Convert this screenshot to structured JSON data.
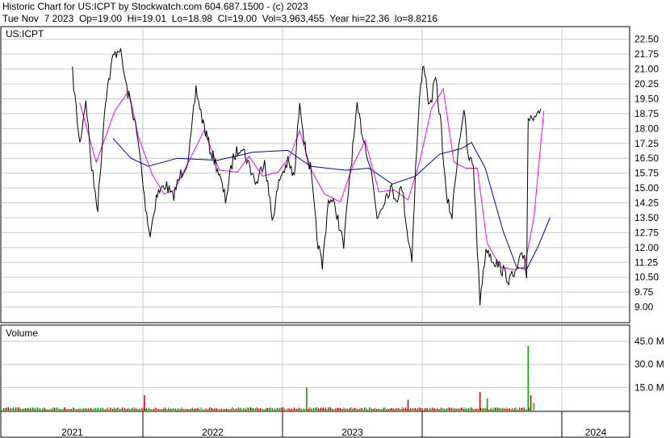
{
  "header": {
    "line1": "Historic Chart for US:ICPT by Stockwatch.com 604.687.1500 - (c) 2023",
    "line2": "Tue Nov  7 2023  Op=19.00  Hi=19.01  Lo=18.98  Cl=19.00  Vol=3,963,455  Year hi=22.36  lo=8.8216"
  },
  "price_panel": {
    "symbol": "US:ICPT"
  },
  "volume_panel": {
    "label": "Volume"
  },
  "colors": {
    "price": "#000000",
    "short_ma": "#ff00ff",
    "long_ma": "#0000cc",
    "vol_up": "#00aa00",
    "vol_down": "#dd0000",
    "grid": "#c8c8c8"
  },
  "chart_data": [
    {
      "type": "line",
      "title": "US:ICPT",
      "x_axis_labels": [
        "2021",
        "2022",
        "2023",
        "2024"
      ],
      "y_ticks": [
        "22.50",
        "21.75",
        "21.00",
        "20.25",
        "19.50",
        "18.75",
        "18.00",
        "17.25",
        "16.50",
        "15.75",
        "15.00",
        "14.25",
        "13.50",
        "12.75",
        "12.00",
        "11.25",
        "10.50",
        "9.75",
        "9.00"
      ],
      "ylim": [
        8.25,
        23.1
      ],
      "grid": true,
      "series": [
        {
          "name": "Price",
          "points": [
            [
              "2020-07-01",
              20.8
            ],
            [
              "2020-07-20",
              17.2
            ],
            [
              "2020-08-05",
              19.5
            ],
            [
              "2020-08-20",
              16.0
            ],
            [
              "2020-09-05",
              14.0
            ],
            [
              "2020-09-25",
              19.5
            ],
            [
              "2020-10-15",
              21.6
            ],
            [
              "2020-11-01",
              22.1
            ],
            [
              "2020-11-20",
              20.0
            ],
            [
              "2020-12-10",
              18.5
            ],
            [
              "2020-12-25",
              16.5
            ],
            [
              "2021-01-05",
              14.5
            ],
            [
              "2021-01-20",
              12.6
            ],
            [
              "2021-02-05",
              14.6
            ],
            [
              "2021-03-01",
              15.2
            ],
            [
              "2021-03-20",
              14.5
            ],
            [
              "2021-04-10",
              15.7
            ],
            [
              "2021-05-01",
              16.5
            ],
            [
              "2021-05-20",
              20.0
            ],
            [
              "2021-06-05",
              18.5
            ],
            [
              "2021-06-25",
              17.0
            ],
            [
              "2021-07-15",
              16.0
            ],
            [
              "2021-08-05",
              14.4
            ],
            [
              "2021-08-25",
              16.5
            ],
            [
              "2021-09-15",
              17.2
            ],
            [
              "2021-10-05",
              16.2
            ],
            [
              "2021-10-25",
              15.2
            ],
            [
              "2021-11-15",
              16.5
            ],
            [
              "2021-12-05",
              13.4
            ],
            [
              "2021-12-25",
              15.5
            ],
            [
              "2022-01-15",
              16.3
            ],
            [
              "2022-02-01",
              15.5
            ],
            [
              "2022-02-15",
              19.5
            ],
            [
              "2022-03-01",
              17.0
            ],
            [
              "2022-03-15",
              16.0
            ],
            [
              "2022-04-01",
              12.5
            ],
            [
              "2022-04-15",
              11.0
            ],
            [
              "2022-05-01",
              14.5
            ],
            [
              "2022-05-20",
              14.0
            ],
            [
              "2022-06-10",
              12.0
            ],
            [
              "2022-06-25",
              15.5
            ],
            [
              "2022-07-15",
              19.0
            ],
            [
              "2022-08-01",
              17.5
            ],
            [
              "2022-08-20",
              16.0
            ],
            [
              "2022-09-05",
              13.5
            ],
            [
              "2022-09-25",
              14.5
            ],
            [
              "2022-10-10",
              15.0
            ],
            [
              "2022-10-25",
              14.5
            ],
            [
              "2022-11-10",
              15.0
            ],
            [
              "2022-11-25",
              12.5
            ],
            [
              "2022-12-05",
              11.5
            ],
            [
              "2022-12-15",
              16.0
            ],
            [
              "2022-12-25",
              19.5
            ],
            [
              "2023-01-05",
              21.4
            ],
            [
              "2023-01-20",
              19.0
            ],
            [
              "2023-02-05",
              20.5
            ],
            [
              "2023-02-20",
              18.0
            ],
            [
              "2023-03-05",
              14.5
            ],
            [
              "2023-03-20",
              13.6
            ],
            [
              "2023-04-05",
              17.0
            ],
            [
              "2023-04-20",
              19.0
            ],
            [
              "2023-05-01",
              16.5
            ],
            [
              "2023-05-15",
              16.2
            ],
            [
              "2023-05-25",
              12.0
            ],
            [
              "2023-06-01",
              9.2
            ],
            [
              "2023-06-10",
              11.0
            ],
            [
              "2023-06-20",
              12.0
            ],
            [
              "2023-07-01",
              11.5
            ],
            [
              "2023-07-15",
              11.2
            ],
            [
              "2023-08-01",
              10.8
            ],
            [
              "2023-08-15",
              10.4
            ],
            [
              "2023-09-01",
              10.6
            ],
            [
              "2023-09-15",
              11.4
            ],
            [
              "2023-09-25",
              11.6
            ],
            [
              "2023-10-01",
              10.6
            ],
            [
              "2023-10-05",
              18.5
            ],
            [
              "2023-10-15",
              18.6
            ],
            [
              "2023-10-25",
              18.9
            ],
            [
              "2023-11-07",
              19.0
            ]
          ]
        },
        {
          "name": "Short MA",
          "points": [
            [
              "2020-07-20",
              19.3
            ],
            [
              "2020-09-01",
              16.3
            ],
            [
              "2020-10-20",
              18.9
            ],
            [
              "2020-11-25",
              19.9
            ],
            [
              "2020-12-20",
              17.6
            ],
            [
              "2021-01-25",
              15.7
            ],
            [
              "2021-02-25",
              14.7
            ],
            [
              "2021-03-25",
              14.9
            ],
            [
              "2021-05-05",
              16.5
            ],
            [
              "2021-06-10",
              17.9
            ],
            [
              "2021-07-20",
              15.9
            ],
            [
              "2021-09-05",
              15.8
            ],
            [
              "2021-10-05",
              16.6
            ],
            [
              "2021-11-10",
              15.6
            ],
            [
              "2021-12-20",
              15.8
            ],
            [
              "2022-01-20",
              16.6
            ],
            [
              "2022-02-15",
              17.9
            ],
            [
              "2022-03-15",
              16.0
            ],
            [
              "2022-04-20",
              14.7
            ],
            [
              "2022-06-01",
              14.3
            ],
            [
              "2022-07-05",
              16.2
            ],
            [
              "2022-08-05",
              17.4
            ],
            [
              "2022-09-10",
              14.8
            ],
            [
              "2022-10-20",
              14.9
            ],
            [
              "2022-11-25",
              14.4
            ],
            [
              "2022-12-25",
              16.3
            ],
            [
              "2023-01-25",
              19.0
            ],
            [
              "2023-02-25",
              20.0
            ],
            [
              "2023-03-25",
              16.3
            ],
            [
              "2023-04-25",
              16.0
            ],
            [
              "2023-05-25",
              16.0
            ],
            [
              "2023-06-20",
              12.2
            ],
            [
              "2023-07-25",
              11.0
            ],
            [
              "2023-08-25",
              10.9
            ],
            [
              "2023-09-25",
              11.0
            ],
            [
              "2023-10-20",
              13.5
            ],
            [
              "2023-11-15",
              18.9
            ]
          ]
        },
        {
          "name": "Long MA",
          "points": [
            [
              "2020-10-15",
              17.5
            ],
            [
              "2020-12-01",
              16.5
            ],
            [
              "2021-01-15",
              16.1
            ],
            [
              "2021-04-01",
              16.5
            ],
            [
              "2021-07-15",
              16.4
            ],
            [
              "2021-10-15",
              16.8
            ],
            [
              "2022-01-15",
              16.9
            ],
            [
              "2022-03-15",
              16.1
            ],
            [
              "2022-06-15",
              15.9
            ],
            [
              "2022-08-15",
              16.0
            ],
            [
              "2022-10-15",
              15.2
            ],
            [
              "2022-12-15",
              15.6
            ],
            [
              "2023-02-15",
              16.7
            ],
            [
              "2023-04-15",
              17.0
            ],
            [
              "2023-05-10",
              17.3
            ],
            [
              "2023-06-15",
              16.0
            ],
            [
              "2023-08-01",
              12.8
            ],
            [
              "2023-09-05",
              11.0
            ],
            [
              "2023-10-01",
              10.9
            ],
            [
              "2023-11-01",
              12.1
            ],
            [
              "2023-12-01",
              13.5
            ]
          ]
        }
      ]
    },
    {
      "type": "bar",
      "title": "Volume",
      "y_ticks": [
        "45.0 M",
        "30.0 M",
        "15.0 M"
      ],
      "ylim": [
        0,
        55
      ],
      "spikes": [
        [
          "2021-01-05",
          10.0,
          "down"
        ],
        [
          "2022-03-05",
          15.0,
          "up"
        ],
        [
          "2022-11-25",
          7.0,
          "down"
        ],
        [
          "2023-06-01",
          12.0,
          "down"
        ],
        [
          "2023-06-20",
          8.0,
          "up"
        ],
        [
          "2023-10-05",
          42.0,
          "up"
        ],
        [
          "2023-10-12",
          10.0,
          "down"
        ],
        [
          "2023-10-20",
          5.0,
          "up"
        ]
      ]
    }
  ]
}
